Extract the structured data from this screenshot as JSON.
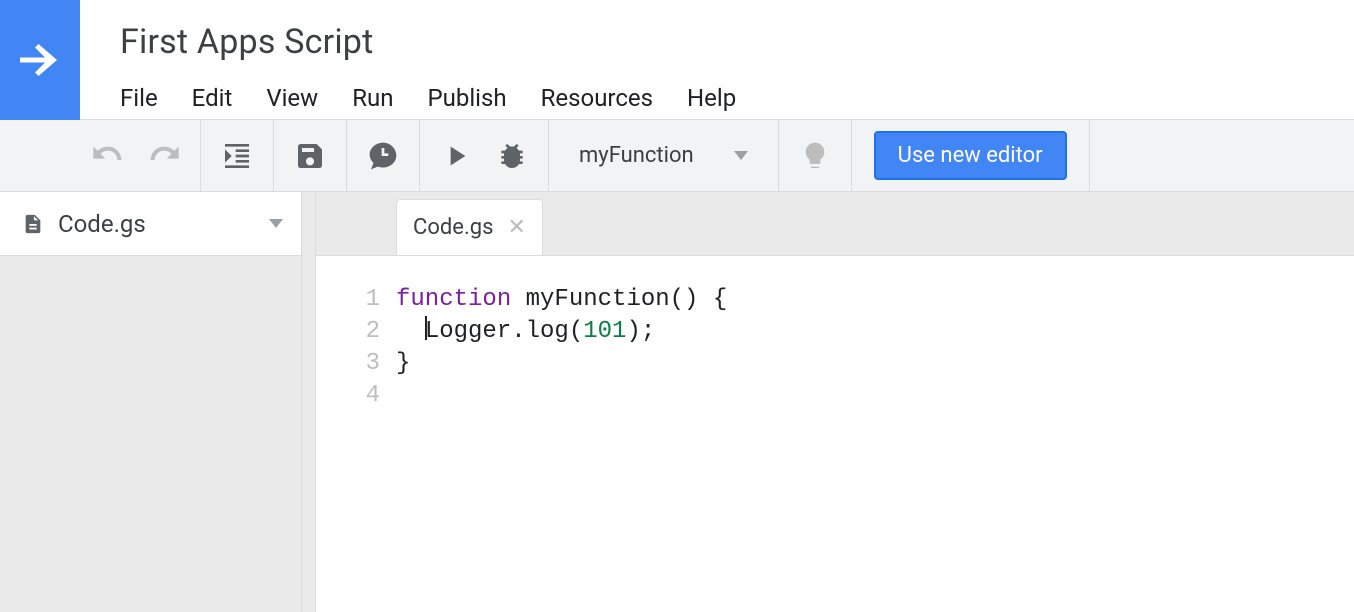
{
  "header": {
    "project_title": "First Apps Script"
  },
  "menubar": {
    "items": [
      "File",
      "Edit",
      "View",
      "Run",
      "Publish",
      "Resources",
      "Help"
    ]
  },
  "toolbar": {
    "selected_function": "myFunction",
    "new_editor_label": "Use new editor"
  },
  "sidebar": {
    "files": [
      {
        "name": "Code.gs"
      }
    ]
  },
  "tabs": [
    {
      "name": "Code.gs",
      "active": true
    }
  ],
  "code": {
    "lines": [
      {
        "n": 1,
        "tokens": [
          {
            "t": "kw",
            "v": "function"
          },
          {
            "t": "txt",
            "v": " myFunction() {"
          }
        ]
      },
      {
        "n": 2,
        "tokens": [
          {
            "t": "txt",
            "v": "  "
          },
          {
            "t": "cursor"
          },
          {
            "t": "txt",
            "v": "Logger.log("
          },
          {
            "t": "num",
            "v": "101"
          },
          {
            "t": "txt",
            "v": ");"
          }
        ]
      },
      {
        "n": 3,
        "tokens": [
          {
            "t": "txt",
            "v": "}"
          }
        ]
      },
      {
        "n": 4,
        "tokens": []
      }
    ]
  }
}
